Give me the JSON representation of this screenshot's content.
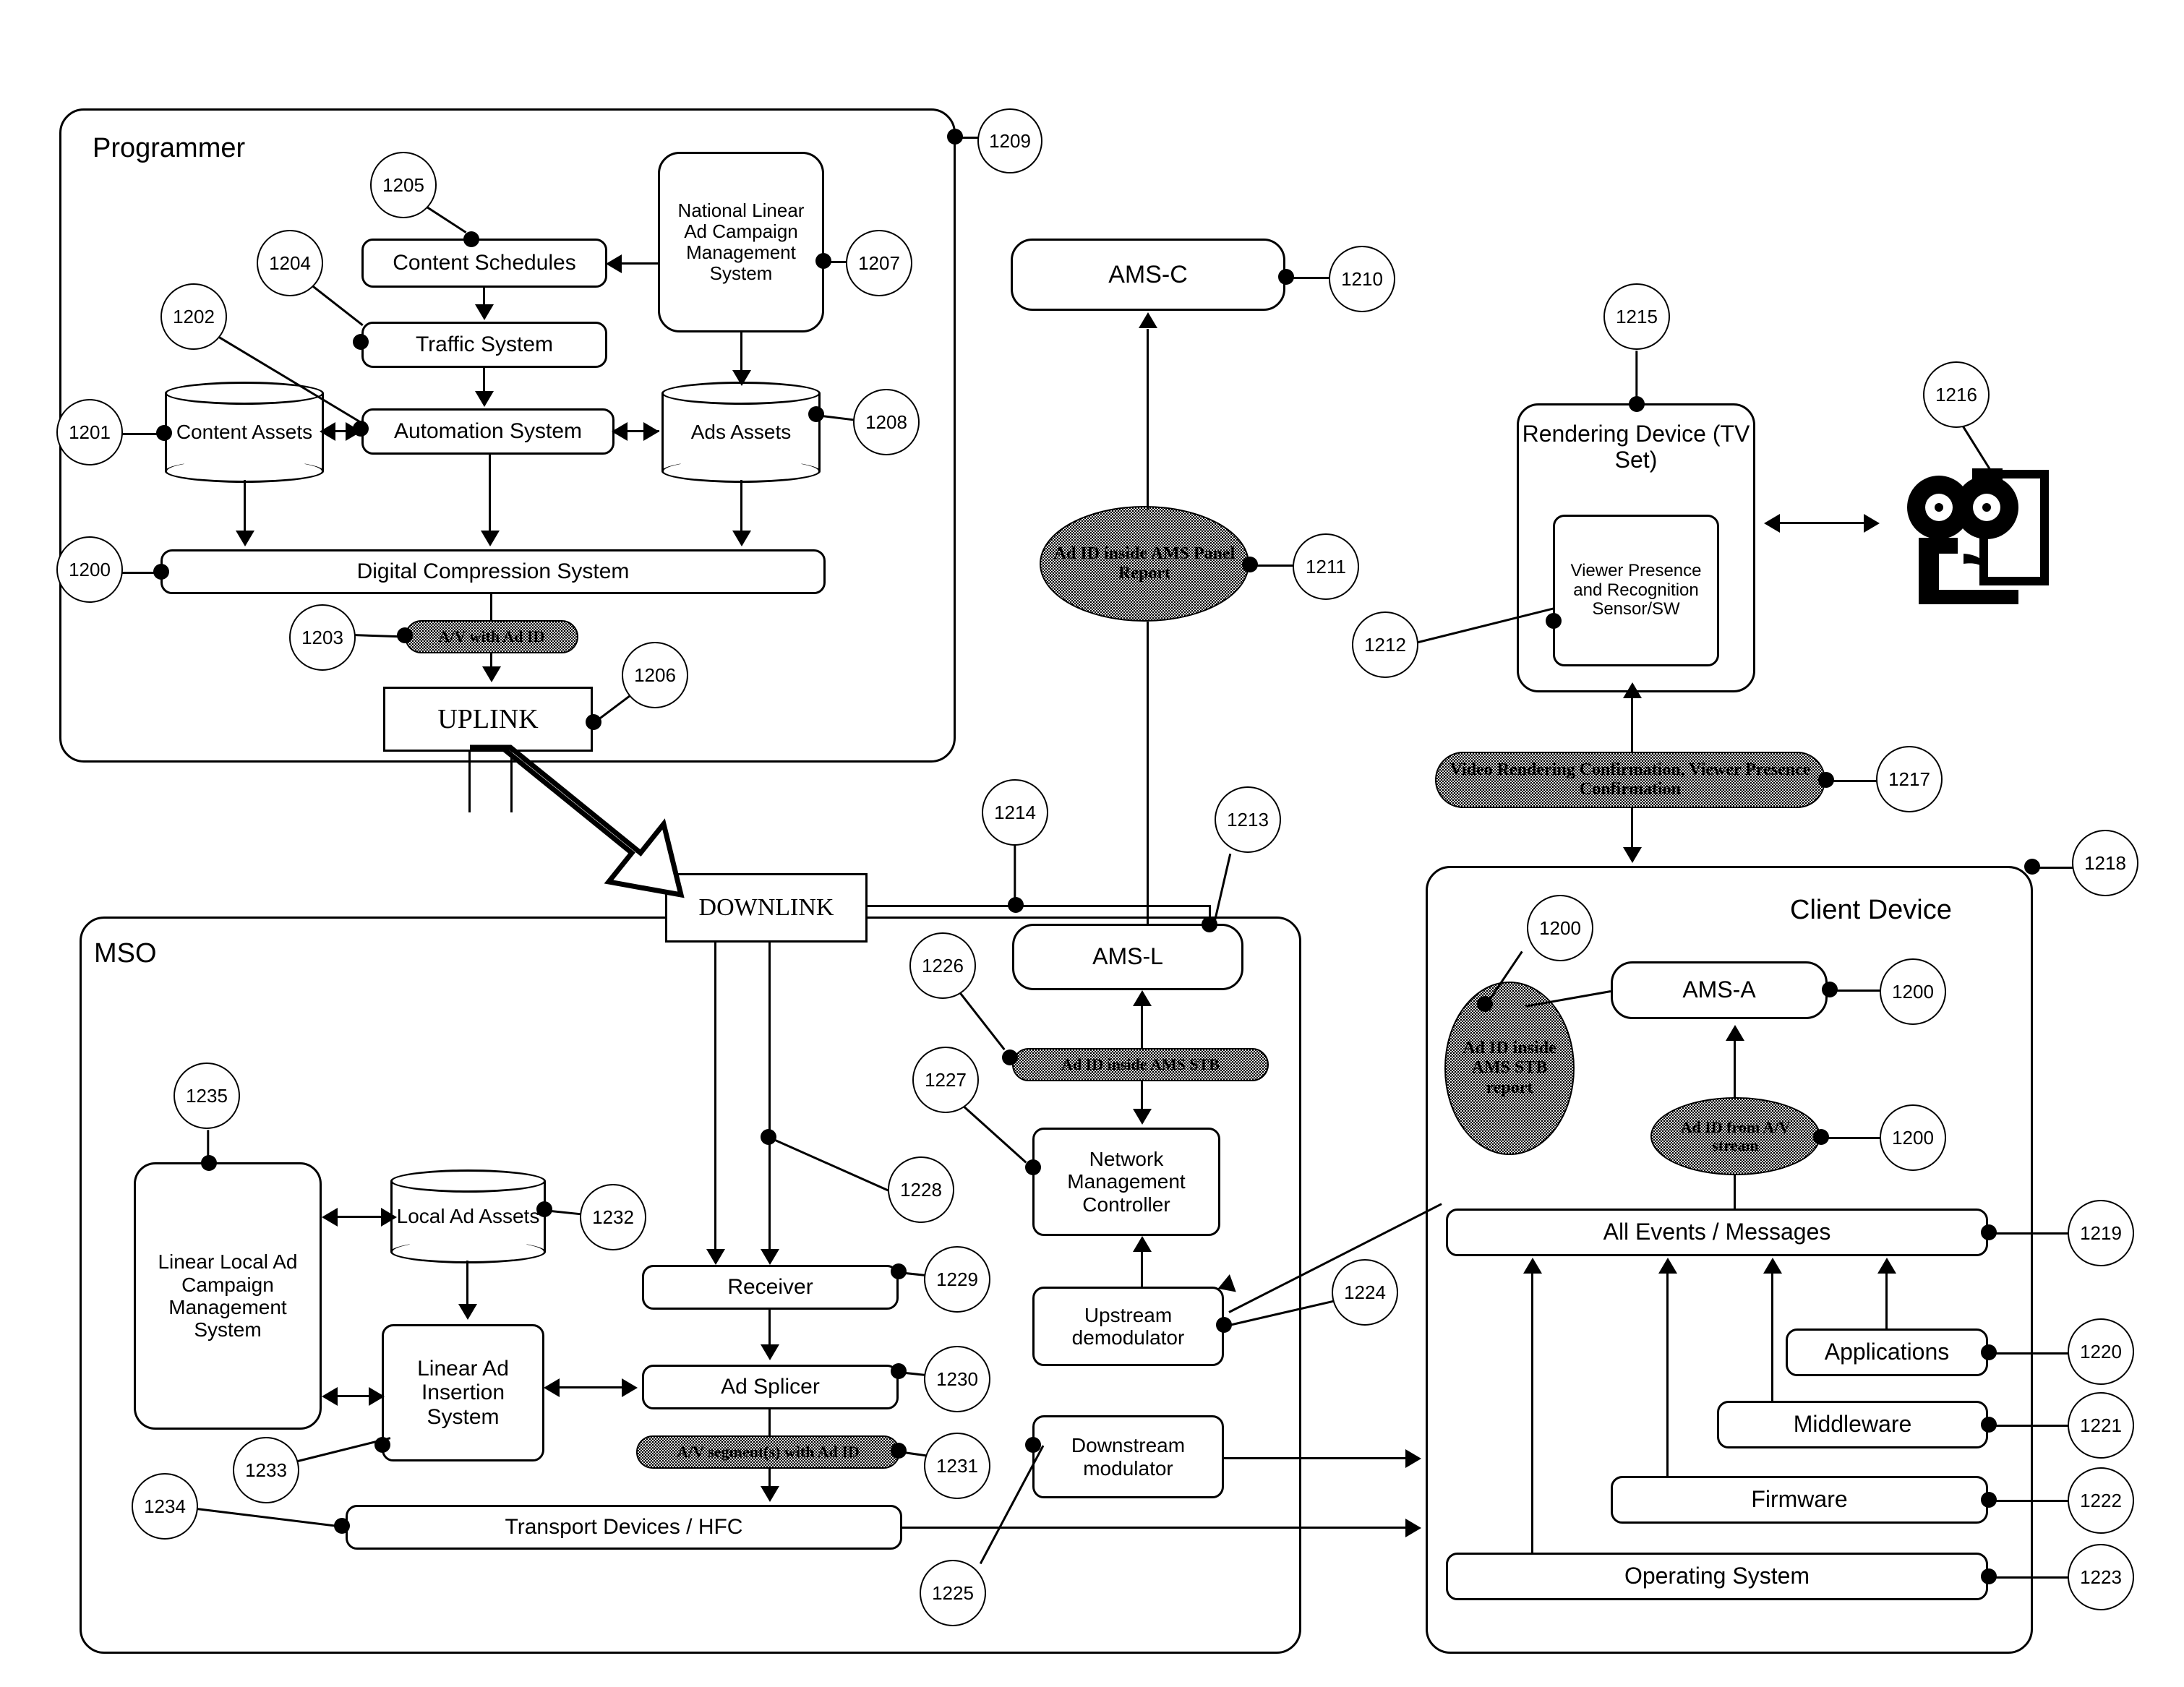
{
  "figure": {
    "groups": [
      {
        "id": "programmer",
        "label": "Programmer"
      },
      {
        "id": "mso",
        "label": "MSO"
      },
      {
        "id": "client",
        "label": "Client Device"
      }
    ],
    "programmer": {
      "content_schedules": "Content Schedules",
      "national_campaign": "National Linear Ad Campaign Management System",
      "traffic_system": "Traffic System",
      "automation_system": "Automation System",
      "content_assets": "Content Assets",
      "ads_assets": "Ads Assets",
      "digital_compression": "Digital Compression System",
      "av_with_ad_id": "A/V with Ad ID",
      "uplink": "UPLINK"
    },
    "headend": {
      "ams_c": "AMS-C",
      "ad_id_inside_ams_panel_report": "Ad ID inside AMS Panel Report",
      "downlink": "DOWNLINK",
      "ams_l": "AMS-L",
      "ad_id_inside_ams_stb": "Ad ID inside AMS STB",
      "network_management_controller": "Network Management Controller",
      "upstream_demodulator": "Upstream demodulator",
      "downstream_modulator": "Downstream modulator"
    },
    "mso": {
      "linear_local_campaign": "Linear Local Ad Campaign Management System",
      "local_ad_assets": "Local Ad Assets",
      "linear_ad_insertion": "Linear Ad Insertion System",
      "receiver": "Receiver",
      "ad_splicer": "Ad Splicer",
      "av_segments_with_ad_id": "A/V segment(s) with Ad ID",
      "transport_devices": "Transport Devices / HFC"
    },
    "rendering": {
      "rendering_device": "Rendering Device (TV Set)",
      "viewer_sensor": "Viewer Presence and Recognition Sensor/SW",
      "video_rendering_confirmation": "Video Rendering Confirmation, Viewer Presence Confirmation"
    },
    "client": {
      "ad_id_inside_ams_stb_report": "Ad ID inside AMS STB report",
      "ams_a": "AMS-A",
      "ad_id_from_av_stream": "Ad ID from A/V stream",
      "all_events_messages": "All Events / Messages",
      "applications": "Applications",
      "middleware": "Middleware",
      "firmware": "Firmware",
      "operating_system": "Operating System"
    },
    "refs": {
      "r1200a": "1200",
      "r1201": "1201",
      "r1202": "1202",
      "r1203": "1203",
      "r1204": "1204",
      "r1205": "1205",
      "r1206": "1206",
      "r1207": "1207",
      "r1208": "1208",
      "r1209": "1209",
      "r1210": "1210",
      "r1211": "1211",
      "r1212": "1212",
      "r1213": "1213",
      "r1214": "1214",
      "r1215": "1215",
      "r1216": "1216",
      "r1217": "1217",
      "r1218": "1218",
      "r1219": "1219",
      "r1220": "1220",
      "r1221": "1221",
      "r1222": "1222",
      "r1223": "1223",
      "r1224": "1224",
      "r1225": "1225",
      "r1226": "1226",
      "r1227": "1227",
      "r1228": "1228",
      "r1229": "1229",
      "r1230": "1230",
      "r1231": "1231",
      "r1232": "1232",
      "r1233": "1233",
      "r1234": "1234",
      "r1235": "1235",
      "r1200b": "1200",
      "r1200c": "1200",
      "r1200d": "1200"
    },
    "colors": {
      "stroke": "#000000",
      "background": "#ffffff",
      "shaded_fill": "#d6d6d6"
    }
  }
}
